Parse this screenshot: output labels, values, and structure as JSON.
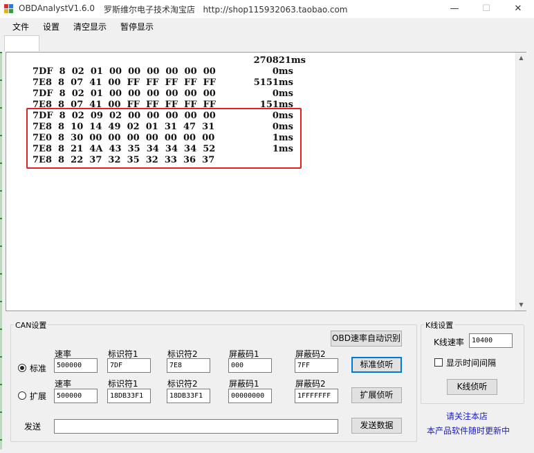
{
  "window": {
    "title": "OBDAnalystV1.6.0",
    "subtitle": "罗斯维尔电子技术淘宝店   http://shop115932063.taobao.com",
    "minimize": "—",
    "maximize": "☐",
    "close": "✕"
  },
  "menu": [
    "文件",
    "设置",
    "清空显示",
    "暂停显示"
  ],
  "log": {
    "header_time": "270821ms",
    "lines": [
      {
        "data": "7DF  8  02  01  00  00  00  00  00  00",
        "time": "0ms"
      },
      {
        "data": "7E8  8  07  41  00  FF  FF  FF  FF  FF",
        "time": "5151ms"
      },
      {
        "data": "7DF  8  02  01  00  00  00  00  00  00",
        "time": "0ms"
      },
      {
        "data": "7E8  8  07  41  00  FF  FF  FF  FF  FF",
        "time": "151ms"
      },
      {
        "data": "7DF  8  02  09  02  00  00  00  00  00",
        "time": "0ms"
      },
      {
        "data": "7E8  8  10  14  49  02  01  31  47  31",
        "time": "0ms"
      },
      {
        "data": "7E0  8  30  00  00  00  00  00  00  00",
        "time": "1ms"
      },
      {
        "data": "7E8  8  21  4A  43  35  34  34  34  52",
        "time": "1ms"
      },
      {
        "data": "7E8  8  22  37  32  35  32  33  36  37",
        "time": ""
      }
    ],
    "highlight_color": "#e02020"
  },
  "can": {
    "group_title": "CAN设置",
    "auto_detect_button": "OBD速率自动识别",
    "standard": {
      "radio_label": "标准",
      "selected": true,
      "rate_label": "速率",
      "rate_value": "500000",
      "id1_label": "标识符1",
      "id1_value": "7DF",
      "id2_label": "标识符2",
      "id2_value": "7E8",
      "mask1_label": "屏蔽码1",
      "mask1_value": "000",
      "mask2_label": "屏蔽码2",
      "mask2_value": "7FF",
      "listen_button": "标准侦听"
    },
    "extended": {
      "radio_label": "扩展",
      "selected": false,
      "rate_label": "速率",
      "rate_value": "500000",
      "id1_label": "标识符1",
      "id1_value": "18DB33F1",
      "id2_label": "标识符2",
      "id2_value": "18DB33F1",
      "mask1_label": "屏蔽码1",
      "mask1_value": "00000000",
      "mask2_label": "屏蔽码2",
      "mask2_value": "1FFFFFFF",
      "listen_button": "扩展侦听"
    },
    "send_label": "发送",
    "send_value": "",
    "send_button": "发送数据"
  },
  "kline": {
    "group_title": "K线设置",
    "rate_label": "K线速率",
    "rate_value": "10400",
    "show_interval_label": "显示时间间隔",
    "show_interval_checked": false,
    "listen_button": "K线侦听"
  },
  "footer": {
    "follow_link": "请关注本店",
    "update_link": "本产品软件随时更新中"
  },
  "icons": {
    "app": "app-icon",
    "scroll_up": "scroll-up-icon",
    "scroll_down": "scroll-down-icon"
  }
}
